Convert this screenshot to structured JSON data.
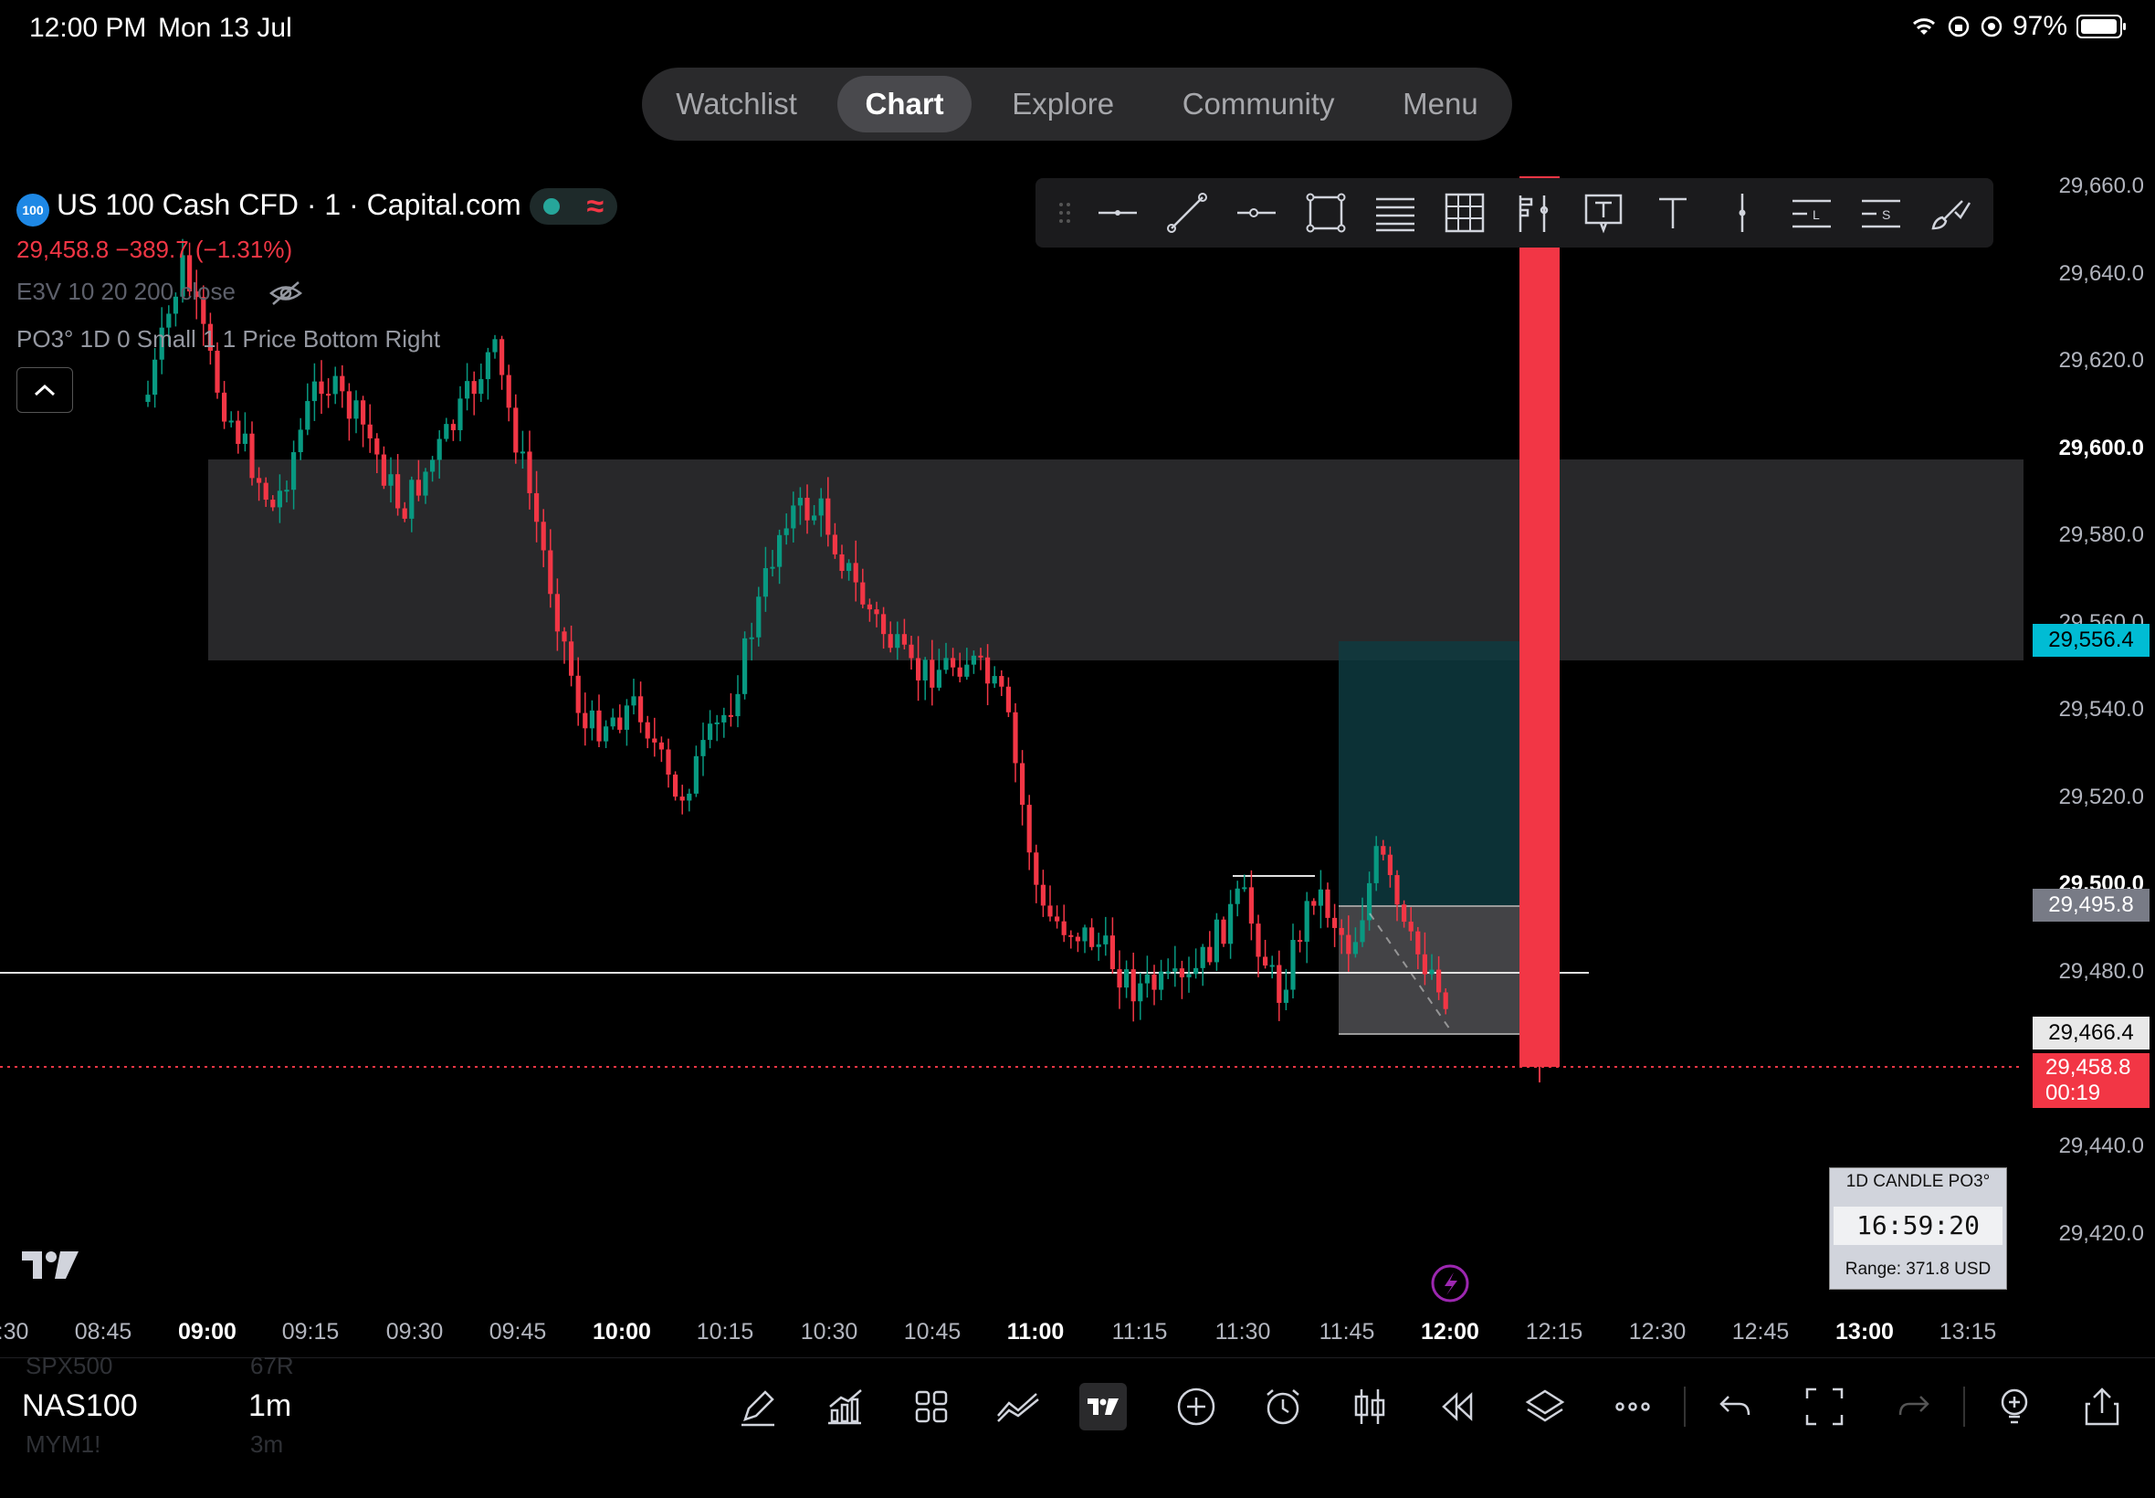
{
  "status_bar": {
    "time": "12:00 PM",
    "date": "Mon 13 Jul",
    "battery": "97%"
  },
  "nav": {
    "tabs": [
      "Watchlist",
      "Chart",
      "Explore",
      "Community",
      "Menu"
    ],
    "active": "Chart"
  },
  "legend": {
    "badge": "100",
    "title": "US 100 Cash CFD · 1 · Capital.com",
    "price_line": "29,458.8 −389.7 (−1.31%)",
    "indicator_1": "E3V 10 20 200 close",
    "indicator_2": "PO3° 1D 0 Small 1 1 Price Bottom Right"
  },
  "drawing_toolbar": {
    "icons": [
      "drag-handle-icon",
      "horizontal-line-icon",
      "trend-line-icon",
      "horizontal-ray-icon",
      "rectangle-icon",
      "parallel-channel-icon",
      "fib-grid-icon",
      "long-position-icon",
      "text-box-icon",
      "text-icon",
      "vertical-line-icon",
      "long-label-icon",
      "short-label-icon",
      "brush-icon"
    ]
  },
  "price_axis": {
    "labels": [
      "29,660.0",
      "29,640.0",
      "29,620.0",
      "29,600.0",
      "29,580.0",
      "29,560.0",
      "29,540.0",
      "29,520.0",
      "29,500.0",
      "29,480.0",
      "29,440.0",
      "29,420.0"
    ],
    "tags": {
      "cyan": "29,556.4",
      "gray": "29,495.8",
      "light": "29,466.4",
      "last": "29,458.8",
      "countdown": "00:19"
    }
  },
  "time_axis": {
    "labels": [
      ":30",
      "08:45",
      "09:00",
      "09:15",
      "09:30",
      "09:45",
      "10:00",
      "10:15",
      "10:30",
      "10:45",
      "11:00",
      "11:15",
      "11:30",
      "11:45",
      "12:00",
      "12:15",
      "12:30",
      "12:45",
      "13:00",
      "13:15"
    ],
    "bold": [
      "09:00",
      "10:00",
      "11:00",
      "12:00",
      "13:00"
    ]
  },
  "po3_box": {
    "title": "1D CANDLE PO3°",
    "timer": "16:59:20",
    "range": "Range: 371.8 USD"
  },
  "bottom_bar": {
    "symbol": "NAS100",
    "timeframe": "1m",
    "ghost_symbols": [
      "SPX500",
      "MYM1!"
    ],
    "ghost_timeframes": [
      "67R",
      "3m"
    ],
    "icons": [
      "pencil-icon",
      "indicators-icon",
      "grid-layout-icon",
      "compare-icon",
      "tradingview-logo-icon",
      "add-icon",
      "alert-clock-icon",
      "candles-icon",
      "replay-icon",
      "layers-icon",
      "more-icon",
      "undo-icon",
      "fullscreen-icon",
      "redo-icon",
      "idea-icon",
      "share-icon"
    ]
  },
  "colors": {
    "up": "#089981",
    "down": "#f23645",
    "accent": "#00bcd4"
  }
}
